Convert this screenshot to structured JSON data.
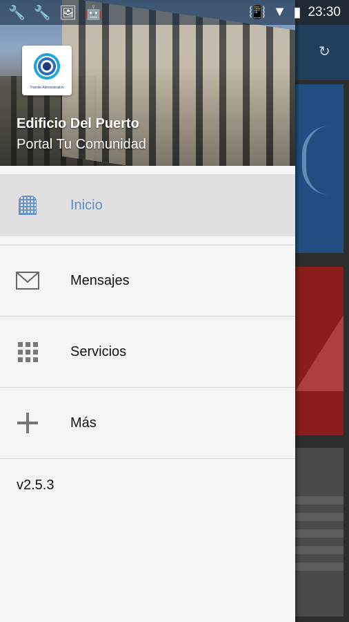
{
  "status_bar": {
    "time": "23:30",
    "left_icons": [
      "wrench-icon",
      "wrench-icon",
      "image-icon",
      "android-icon"
    ],
    "right_icons": [
      "vibrate-icon",
      "wifi-icon",
      "battery-icon"
    ]
  },
  "drawer": {
    "header": {
      "title": "Edificio Del Puerto",
      "subtitle": "Portal Tu Comunidad",
      "logo_caption": "Tramite Administrativo"
    },
    "menu": [
      {
        "label": "Inicio",
        "icon": "building-icon",
        "active": true
      },
      {
        "label": "Mensajes",
        "icon": "envelope-icon",
        "active": false
      },
      {
        "label": "Servicios",
        "icon": "grid-icon",
        "active": false
      },
      {
        "label": "Más",
        "icon": "plus-icon",
        "active": false
      }
    ],
    "version": "v2.5.3"
  },
  "background_app": {
    "tile_colors": [
      "#1f4f80",
      "#8a1c1c",
      "#4a4a4a"
    ]
  },
  "colors": {
    "active_label": "#5b8ec7",
    "active_bg": "#e0e0e0",
    "drawer_bg": "#f5f5f5"
  }
}
